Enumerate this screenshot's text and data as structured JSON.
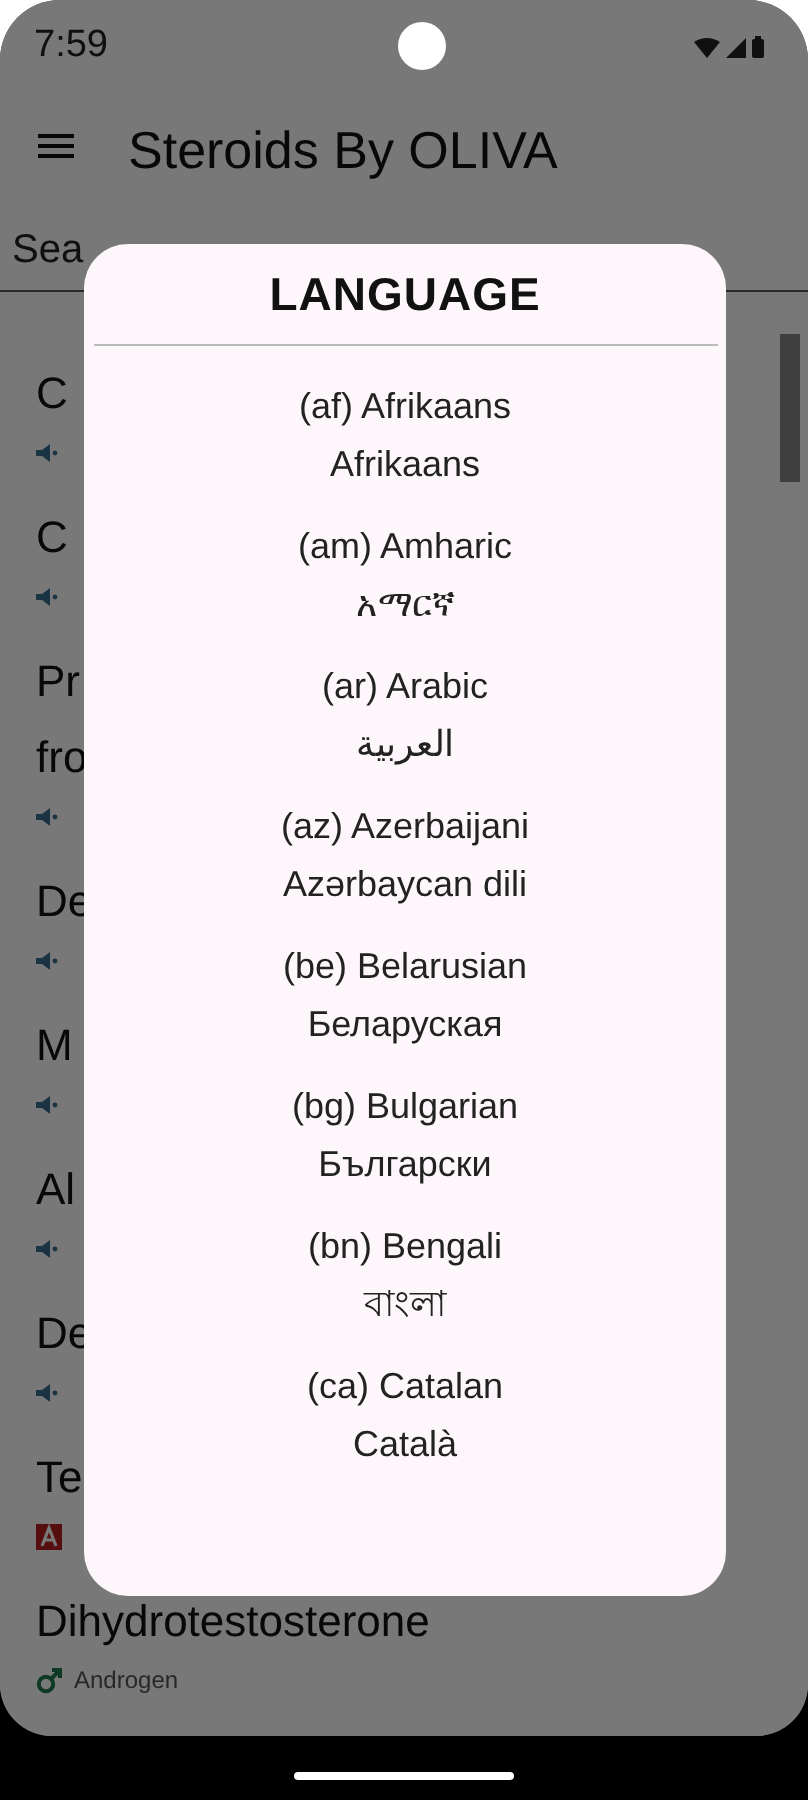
{
  "status_bar": {
    "time": "7:59"
  },
  "app_bar": {
    "title": "Steroids By OLIVA"
  },
  "search": {
    "placeholder": "Sea"
  },
  "list": [
    {
      "title_lines": [
        "C"
      ],
      "kind": "speaker"
    },
    {
      "title_lines": [
        "C"
      ],
      "kind": "speaker"
    },
    {
      "title_lines": [
        "Pr",
        "fro"
      ],
      "kind": "speaker"
    },
    {
      "title_lines": [
        "De"
      ],
      "kind": "speaker"
    },
    {
      "title_lines": [
        "M"
      ],
      "kind": "speaker"
    },
    {
      "title_lines": [
        "Al"
      ],
      "kind": "speaker"
    },
    {
      "title_lines": [
        "De"
      ],
      "kind": "speaker"
    },
    {
      "title_lines": [
        "Te"
      ],
      "kind": "letter"
    },
    {
      "title_lines": [
        "Dihydrotestosterone"
      ],
      "kind": "male",
      "subtitle": "Androgen"
    }
  ],
  "dialog": {
    "title": "LANGUAGE",
    "languages": [
      {
        "name": "(af) Afrikaans",
        "native": "Afrikaans"
      },
      {
        "name": "(am) Amharic",
        "native": "አማርኛ"
      },
      {
        "name": "(ar) Arabic",
        "native": "العربية"
      },
      {
        "name": "(az) Azerbaijani",
        "native": "Azərbaycan dili"
      },
      {
        "name": "(be) Belarusian",
        "native": "Беларуская"
      },
      {
        "name": "(bg) Bulgarian",
        "native": "Български"
      },
      {
        "name": "(bn) Bengali",
        "native": "বাংলা"
      },
      {
        "name": "(ca) Catalan",
        "native": "Català"
      }
    ]
  }
}
